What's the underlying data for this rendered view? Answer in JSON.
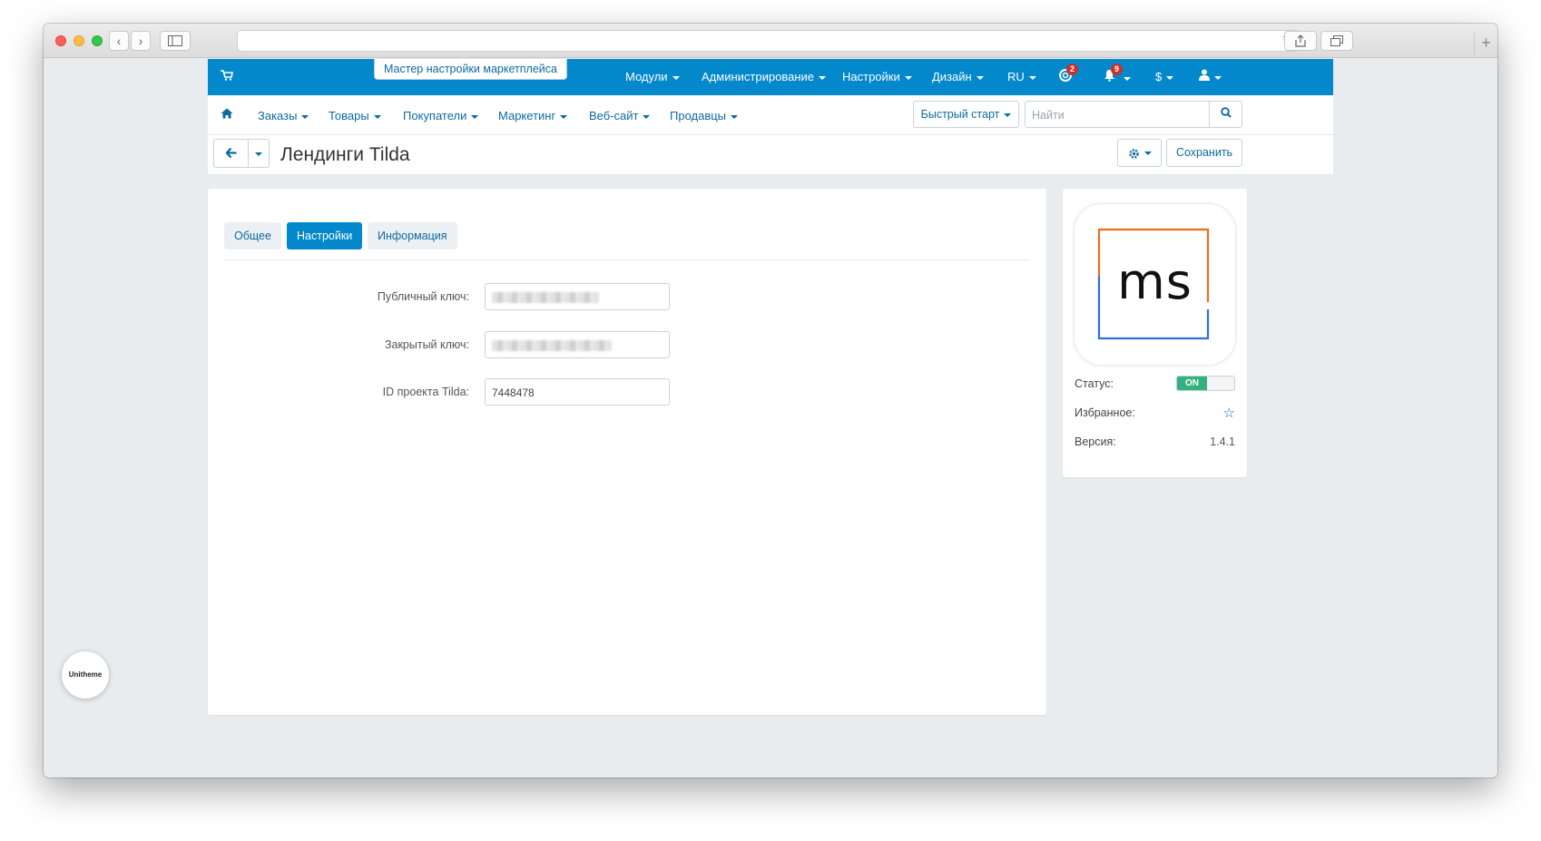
{
  "browser": {
    "nav_back": "‹",
    "nav_forward": "›",
    "reload": "↻",
    "new_tab": "+"
  },
  "topnav": {
    "wizard": "Мастер настройки маркетплейса",
    "menus": [
      {
        "label": "Модули"
      },
      {
        "label": "Администрирование"
      },
      {
        "label": "Настройки"
      },
      {
        "label": "Дизайн"
      },
      {
        "label": "RU"
      }
    ],
    "support_badge": "2",
    "notifications_badge": "9",
    "currency": "$"
  },
  "subnav": {
    "items": [
      {
        "label": "Заказы"
      },
      {
        "label": "Товары"
      },
      {
        "label": "Покупатели"
      },
      {
        "label": "Маркетинг"
      },
      {
        "label": "Веб-сайт"
      },
      {
        "label": "Продавцы"
      }
    ],
    "quick_start": "Быстрый старт",
    "search_placeholder": "Найти"
  },
  "page": {
    "title": "Лендинги Tilda",
    "save": "Сохранить"
  },
  "tabs": [
    {
      "label": "Общее",
      "active": false
    },
    {
      "label": "Настройки",
      "active": true
    },
    {
      "label": "Информация",
      "active": false
    }
  ],
  "form": {
    "public_key_label": "Публичный ключ:",
    "secret_key_label": "Закрытый ключ:",
    "project_id_label": "ID проекта Tilda:",
    "project_id_value": "7448478"
  },
  "addon": {
    "logo_text": "ms",
    "status_label": "Статус:",
    "status_value": "ON",
    "favorite_label": "Избранное:",
    "version_label": "Версия:",
    "version_value": "1.4.1"
  },
  "widget": {
    "label": "Unitheme"
  },
  "colors": {
    "primary": "#0388cc",
    "logo_orange": "#f26b1d",
    "logo_blue": "#2f6fd6",
    "status_on": "#34b27d"
  }
}
